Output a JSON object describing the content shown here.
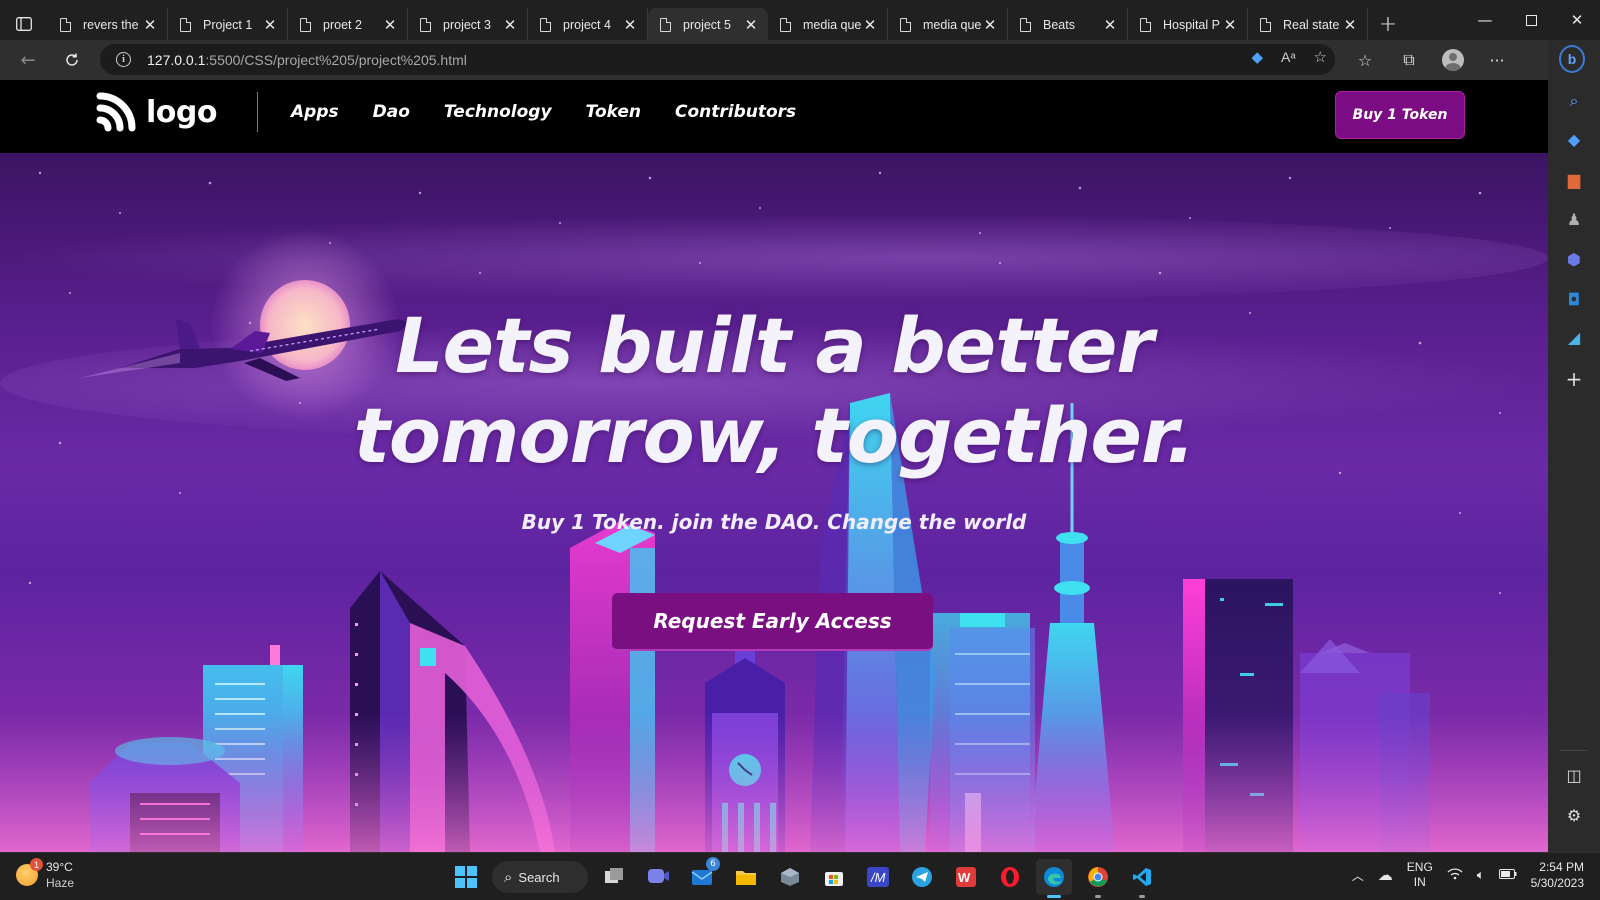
{
  "browser": {
    "tabs": [
      {
        "label": "revers the"
      },
      {
        "label": "Project 1"
      },
      {
        "label": "proet 2"
      },
      {
        "label": "project 3"
      },
      {
        "label": "project 4"
      },
      {
        "label": "project 5",
        "active": true
      },
      {
        "label": "media que"
      },
      {
        "label": "media que"
      },
      {
        "label": "Beats"
      },
      {
        "label": "Hospital P"
      },
      {
        "label": "Real state"
      }
    ],
    "url_host": "127.0.0.1",
    "url_path": ":5500/CSS/project%205/project%205.html"
  },
  "site": {
    "logo_text": "logo",
    "nav": {
      "apps": "Apps",
      "dao": "Dao",
      "technology": "Technology",
      "token": "Token",
      "contributors": "Contributors"
    },
    "buy_button": "Buy 1 Token",
    "hero": {
      "title_line1": "Lets built a better",
      "title_line2": "tomorrow, together.",
      "subtitle": "Buy 1 Token. join the DAO. Change the world",
      "cta": "Request Early Access"
    },
    "colors": {
      "accent": "#7b0c83",
      "nav_bg": "#000000",
      "hero_top": "#3c1463",
      "hero_bottom": "#9c3bb5"
    }
  },
  "taskbar": {
    "weather_temp": "39°C",
    "weather_desc": "Haze",
    "weather_badge": "1",
    "search_label": "Search",
    "mail_badge": "6",
    "lang_line1": "ENG",
    "lang_line2": "IN",
    "time": "2:54 PM",
    "date": "5/30/2023"
  }
}
